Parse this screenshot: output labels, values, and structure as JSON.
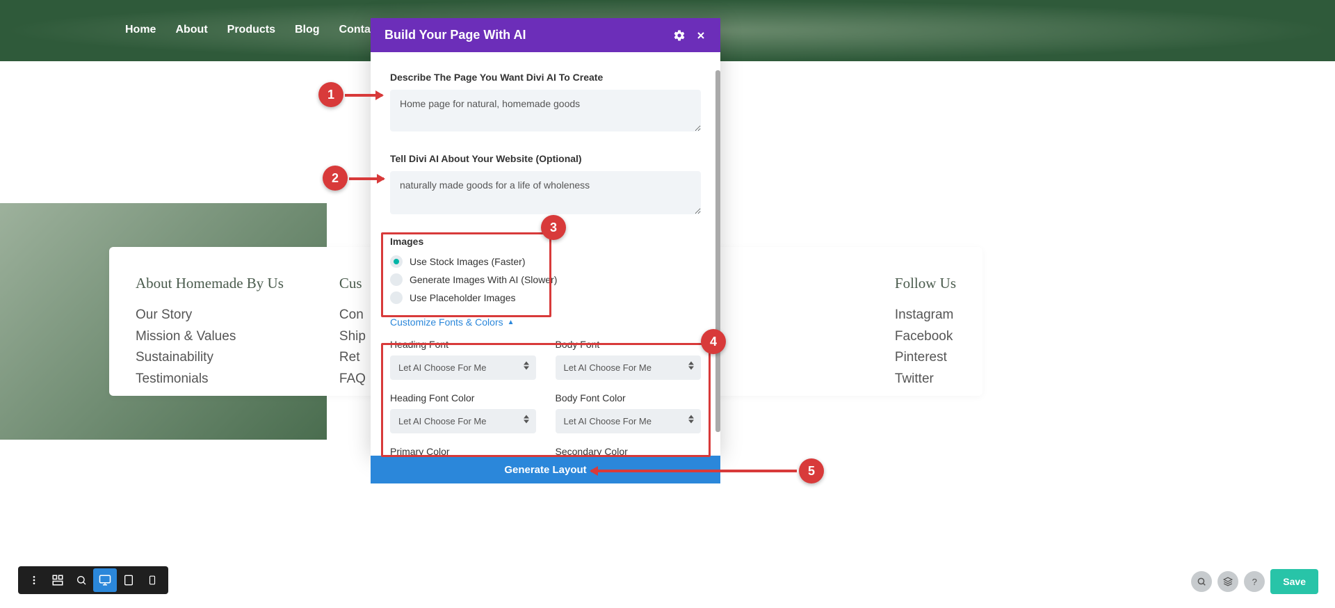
{
  "nav": {
    "items": [
      "Home",
      "About",
      "Products",
      "Blog",
      "Contact"
    ]
  },
  "footer": {
    "col1": {
      "heading": "About Homemade By Us",
      "links": [
        "Our Story",
        "Mission & Values",
        "Sustainability",
        "Testimonials"
      ]
    },
    "col2": {
      "heading": "Cus",
      "links": [
        "Con",
        "Ship",
        "Ret",
        "FAQ"
      ]
    },
    "col3": {
      "heading": "Follow Us",
      "links": [
        "Instagram",
        "Facebook",
        "Pinterest",
        "Twitter"
      ]
    }
  },
  "modal": {
    "title": "Build Your Page With AI",
    "describe_label": "Describe The Page You Want Divi AI To Create",
    "describe_value": "Home page for natural, homemade goods",
    "about_label": "Tell Divi AI About Your Website (Optional)",
    "about_value": "naturally made goods for a life of wholeness",
    "images_label": "Images",
    "images_options": [
      "Use Stock Images (Faster)",
      "Generate Images With AI (Slower)",
      "Use Placeholder Images"
    ],
    "customize_link": "Customize Fonts & Colors",
    "fields": {
      "heading_font": {
        "label": "Heading Font",
        "value": "Let AI Choose For Me"
      },
      "body_font": {
        "label": "Body Font",
        "value": "Let AI Choose For Me"
      },
      "heading_color": {
        "label": "Heading Font Color",
        "value": "Let AI Choose For Me"
      },
      "body_color": {
        "label": "Body Font Color",
        "value": "Let AI Choose For Me"
      },
      "primary_color": {
        "label": "Primary Color"
      },
      "secondary_color": {
        "label": "Secondary Color"
      }
    },
    "generate_label": "Generate Layout"
  },
  "annotations": {
    "c1": "1",
    "c2": "2",
    "c3": "3",
    "c4": "4",
    "c5": "5"
  },
  "builder": {
    "save": "Save"
  }
}
